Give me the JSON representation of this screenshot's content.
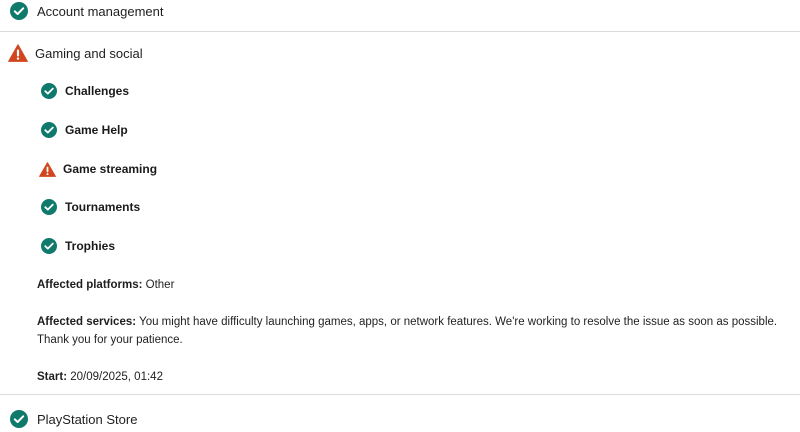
{
  "colors": {
    "ok": "#0f7a6b",
    "warn": "#d0461f"
  },
  "sections": {
    "account": {
      "label": "Account management",
      "status_icon": "check-circle-icon"
    },
    "gaming": {
      "label": "Gaming and social",
      "status_icon": "warning-triangle-icon",
      "services": [
        {
          "label": "Challenges",
          "status_icon": "check-circle-icon"
        },
        {
          "label": "Game Help",
          "status_icon": "check-circle-icon"
        },
        {
          "label": "Game streaming",
          "status_icon": "warning-triangle-icon"
        },
        {
          "label": "Tournaments",
          "status_icon": "check-circle-icon"
        },
        {
          "label": "Trophies",
          "status_icon": "check-circle-icon"
        }
      ],
      "affected_platforms": {
        "label": "Affected platforms:",
        "value": "Other"
      },
      "affected_services": {
        "label": "Affected services:",
        "value": "You might have difficulty launching games, apps, or network features. We're working to resolve the issue as soon as possible. Thank you for your patience."
      },
      "start": {
        "label": "Start:",
        "value": "20/09/2025, 01:42"
      }
    },
    "store": {
      "label": "PlayStation Store",
      "status_icon": "check-circle-icon"
    }
  }
}
